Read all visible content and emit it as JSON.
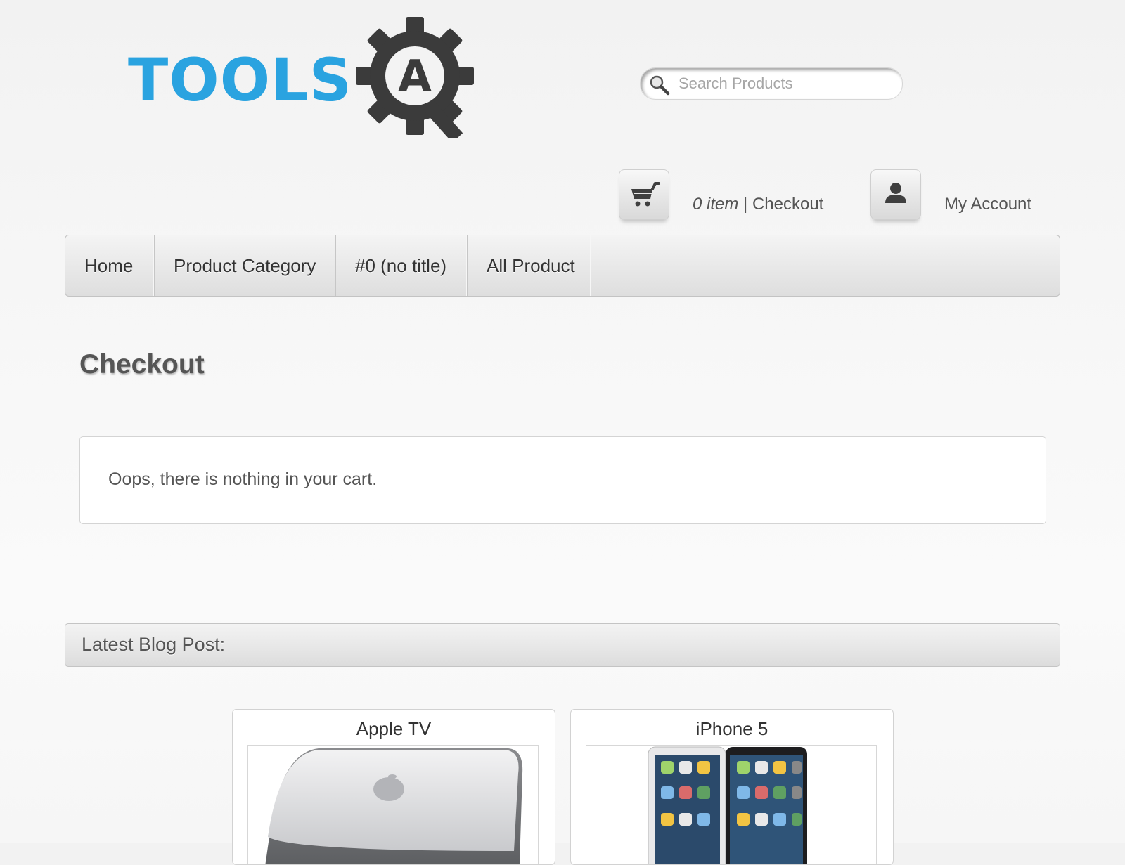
{
  "header": {
    "logo_text": "TOOLS",
    "logo_gear_letter": "A",
    "search": {
      "placeholder": "Search Products",
      "value": ""
    },
    "cart": {
      "count_label": "0 item",
      "separator": " | ",
      "checkout_label": "Checkout"
    },
    "account": {
      "label": "My Account"
    }
  },
  "nav": {
    "items": [
      {
        "label": "Home"
      },
      {
        "label": "Product Category"
      },
      {
        "label": "#0 (no title)"
      },
      {
        "label": "All Product"
      }
    ]
  },
  "main": {
    "title": "Checkout",
    "empty_cart_message": "Oops, there is nothing in your cart."
  },
  "blog": {
    "heading": "Latest Blog Post:",
    "posts": [
      {
        "title": "Apple TV"
      },
      {
        "title": "iPhone 5"
      }
    ]
  },
  "colors": {
    "logo_blue": "#2aa3e0",
    "logo_gear": "#3b3b3b"
  },
  "icons": [
    "search-icon",
    "cart-icon",
    "user-icon",
    "gear-logo-icon"
  ]
}
